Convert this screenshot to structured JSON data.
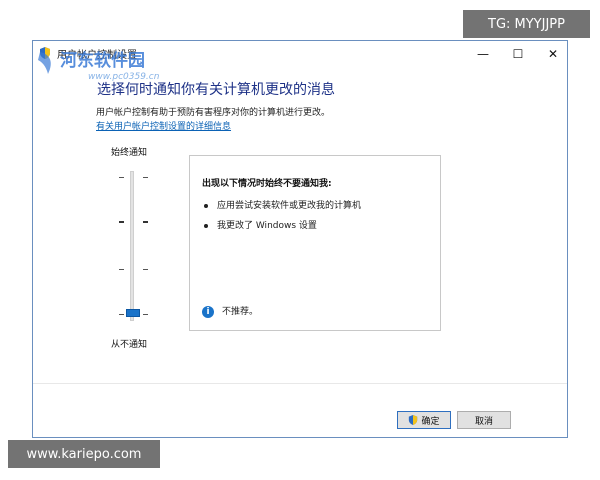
{
  "window": {
    "title": "用户帐户控制设置",
    "controls": {
      "minimize": "—",
      "maximize": "☐",
      "close": "✕"
    }
  },
  "heading": "选择何时通知你有关计算机更改的消息",
  "description": "用户帐户控制有助于预防有害程序对你的计算机进行更改。",
  "link": "有关用户帐户控制设置的详细信息",
  "slider": {
    "top_label": "始终通知",
    "bottom_label": "从不通知",
    "level": 0,
    "levels": 4
  },
  "panel": {
    "title": "出现以下情况时始终不要通知我:",
    "items": [
      "应用尝试安装软件或更改我的计算机",
      "我更改了 Windows 设置"
    ],
    "note": "不推荐。"
  },
  "buttons": {
    "ok": "确定",
    "cancel": "取消"
  },
  "overlays": {
    "watermark_text": "河东软件园",
    "watermark_url": "www.pc0359.cn",
    "tg_badge": "TG: MYYJJPP",
    "site_badge": "www.kariepo.com"
  },
  "colors": {
    "accent": "#1a73c9",
    "heading": "#1e3287",
    "link": "#0b62b5"
  }
}
